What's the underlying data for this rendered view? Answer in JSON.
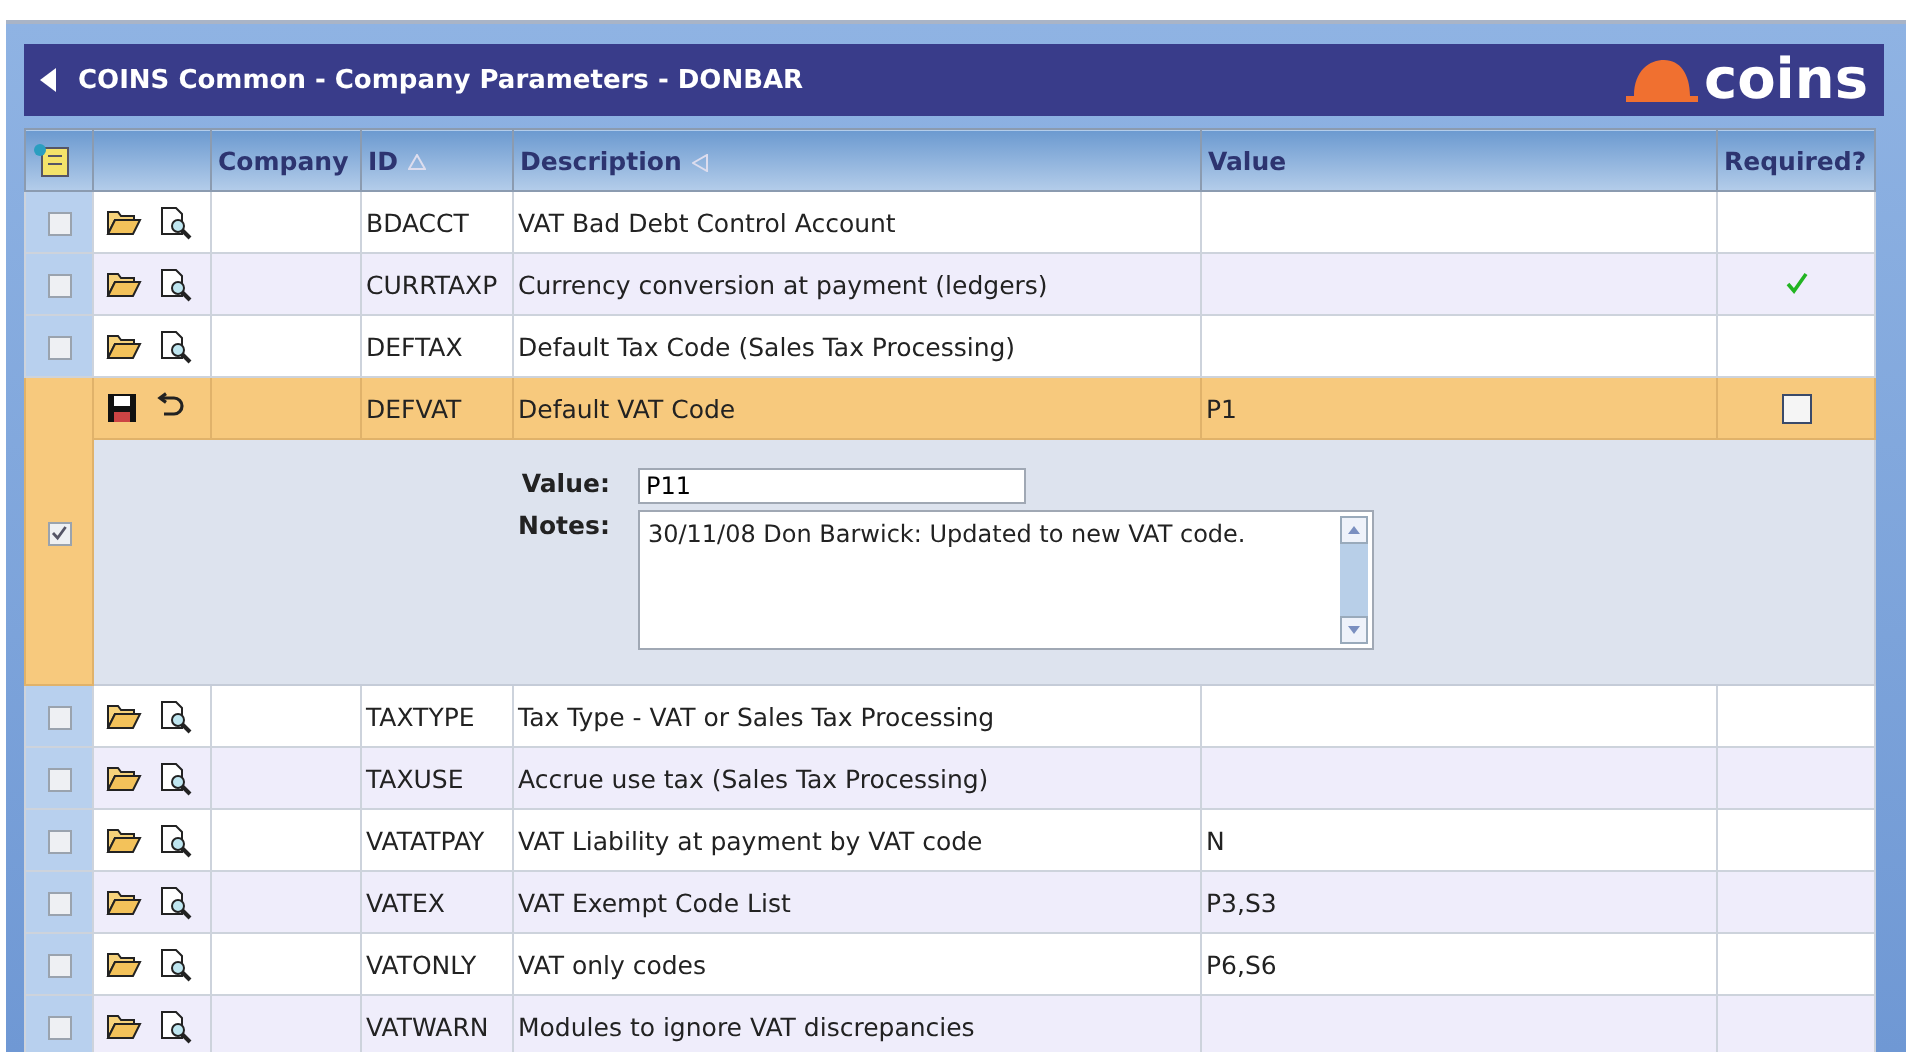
{
  "window": {
    "title": "COINS Common - Company Parameters - DONBAR",
    "logo": "coins"
  },
  "table": {
    "columns": [
      {
        "kind": "tool"
      },
      {
        "kind": "actions"
      },
      {
        "label": "Company",
        "kind": "text"
      },
      {
        "label": "ID",
        "kind": "sort-up"
      },
      {
        "label": "Description",
        "kind": "sort-left"
      },
      {
        "label": "Value",
        "kind": "text"
      },
      {
        "label": "Required?",
        "kind": "text"
      }
    ],
    "rows": [
      {
        "kind": "view",
        "selected": false,
        "company": "",
        "id": "BDACCT",
        "description": "VAT Bad Debt Control Account",
        "value": "",
        "required": false
      },
      {
        "kind": "view",
        "selected": false,
        "company": "",
        "id": "CURRTAXP",
        "description": "Currency conversion at payment (ledgers)",
        "value": "",
        "required": true
      },
      {
        "kind": "view",
        "selected": false,
        "company": "",
        "id": "DEFTAX",
        "description": "Default Tax Code (Sales Tax Processing)",
        "value": "",
        "required": false
      },
      {
        "kind": "edit",
        "selected": true,
        "company": "",
        "id": "DEFVAT",
        "description": "Default VAT Code",
        "value": "P1",
        "required": false,
        "editor": {
          "value_label": "Value:",
          "value": "P11",
          "notes_label": "Notes:",
          "notes": "30/11/08 Don Barwick: Updated to new VAT code."
        }
      },
      {
        "kind": "view",
        "selected": false,
        "company": "",
        "id": "TAXTYPE",
        "description": "Tax Type - VAT or Sales Tax Processing",
        "value": "",
        "required": false
      },
      {
        "kind": "view",
        "selected": false,
        "company": "",
        "id": "TAXUSE",
        "description": "Accrue use tax (Sales Tax Processing)",
        "value": "",
        "required": false
      },
      {
        "kind": "view",
        "selected": false,
        "company": "",
        "id": "VATATPAY",
        "description": "VAT Liability at payment by VAT code",
        "value": "N",
        "required": false
      },
      {
        "kind": "view",
        "selected": false,
        "company": "",
        "id": "VATEX",
        "description": "VAT Exempt Code List",
        "value": "P3,S3",
        "required": false
      },
      {
        "kind": "view",
        "selected": false,
        "company": "",
        "id": "VATONLY",
        "description": "VAT only codes",
        "value": "P6,S6",
        "required": false
      },
      {
        "kind": "view",
        "selected": false,
        "company": "",
        "id": "VATWARN",
        "description": "Modules to ignore VAT discrepancies",
        "value": "",
        "required": false
      }
    ]
  }
}
